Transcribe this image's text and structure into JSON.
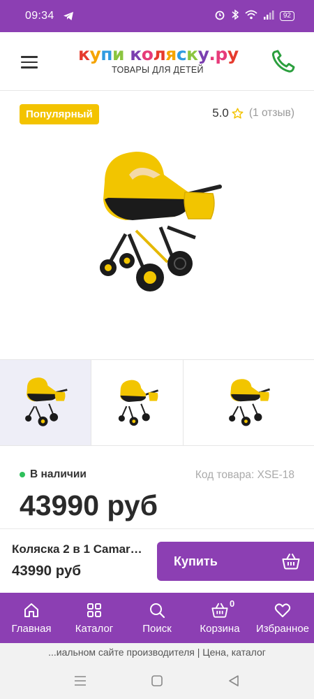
{
  "status_bar": {
    "time": "09:34",
    "battery": "92"
  },
  "header": {
    "logo_text": "купи коляску.ру",
    "logo_subtitle": "ТОВАРЫ ДЛЯ ДЕТЕЙ",
    "logo_colors": [
      "#e63b2e",
      "#f5a400",
      "#2f9be0",
      "#8bc53f",
      "#7b3fb0",
      "#e63b7a"
    ]
  },
  "product": {
    "badge": "Популярный",
    "rating_score": "5.0",
    "reviews": "(1 отзыв)",
    "availability": "В наличии",
    "sku": "Код товара: XSE-18",
    "price": "43990 руб",
    "accent_color": "#f3c300"
  },
  "buy_bar": {
    "name": "Коляска 2 в 1 Camar…",
    "price": "43990 руб",
    "buy_label": "Купить"
  },
  "bottom_nav": {
    "items": [
      {
        "label": "Главная",
        "icon": "home-icon"
      },
      {
        "label": "Каталог",
        "icon": "grid-icon"
      },
      {
        "label": "Поиск",
        "icon": "search-icon"
      },
      {
        "label": "Корзина",
        "icon": "basket-icon"
      },
      {
        "label": "Избранное",
        "icon": "heart-icon"
      }
    ],
    "cart_count": "0"
  },
  "browser": {
    "url_text": "...иальном сайте производителя | Цена, каталог"
  },
  "theme": {
    "primary": "#8c3fb3",
    "in_stock": "#2ec05b"
  }
}
